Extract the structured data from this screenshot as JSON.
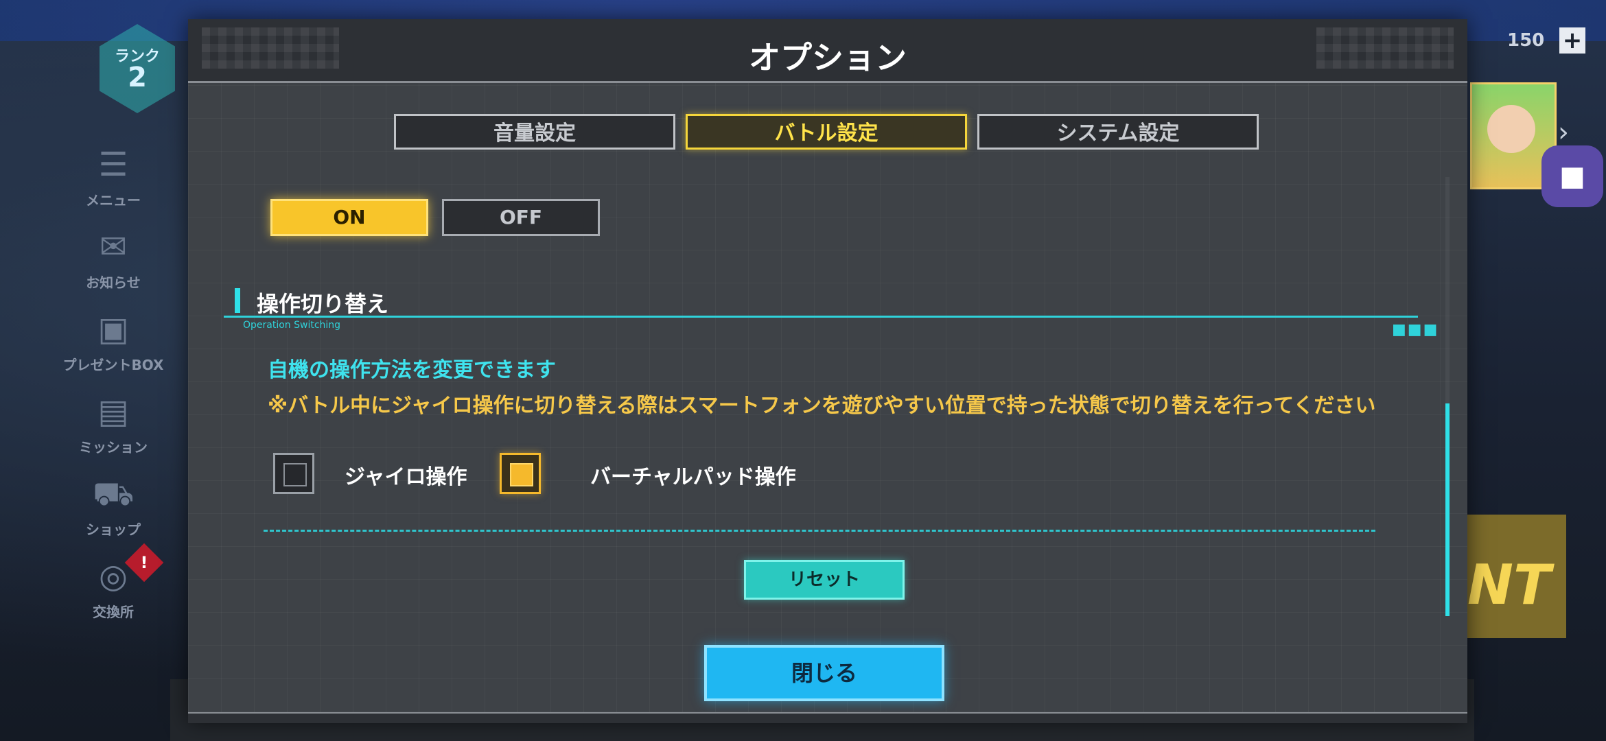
{
  "background": {
    "rank": {
      "label": "ランク",
      "value": "2"
    },
    "side_menu": [
      {
        "label": "メニュー",
        "icon": "menu-icon"
      },
      {
        "label": "お知らせ",
        "icon": "mail-icon"
      },
      {
        "label": "プレゼントBOX",
        "icon": "gift-icon"
      },
      {
        "label": "ミッション",
        "icon": "clipboard-icon"
      },
      {
        "label": "ショップ",
        "icon": "cart-icon"
      },
      {
        "label": "交換所",
        "icon": "exchange-icon",
        "badge": "!"
      }
    ],
    "currency_amount": "150",
    "currency_plus": "+",
    "gacha_arrow": "›",
    "event_text": "NT"
  },
  "dialog": {
    "title": "オプション",
    "tabs": [
      {
        "label": "音量設定",
        "active": false
      },
      {
        "label": "バトル設定",
        "active": true
      },
      {
        "label": "システム設定",
        "active": false
      }
    ],
    "toggle": {
      "on_label": "ON",
      "off_label": "OFF",
      "selected": "ON"
    },
    "section": {
      "title": "操作切り替え",
      "subtitle": "Operation Switching",
      "desc1": "自機の操作方法を変更できます",
      "desc2": "※バトル中にジャイロ操作に切り替える際はスマートフォンを遊びやすい位置で持った状態で切り替えを行ってください",
      "options": [
        {
          "label": "ジャイロ操作",
          "selected": false
        },
        {
          "label": "バーチャルパッド操作",
          "selected": true
        }
      ]
    },
    "reset_label": "リセット",
    "close_label": "閉じる"
  },
  "colors": {
    "accent_yellow": "#f5d63b",
    "accent_cyan": "#2fe0e8",
    "warning_text": "#f6c84a",
    "close_button": "#1fb7f2",
    "reset_button": "#2bc9c0"
  }
}
